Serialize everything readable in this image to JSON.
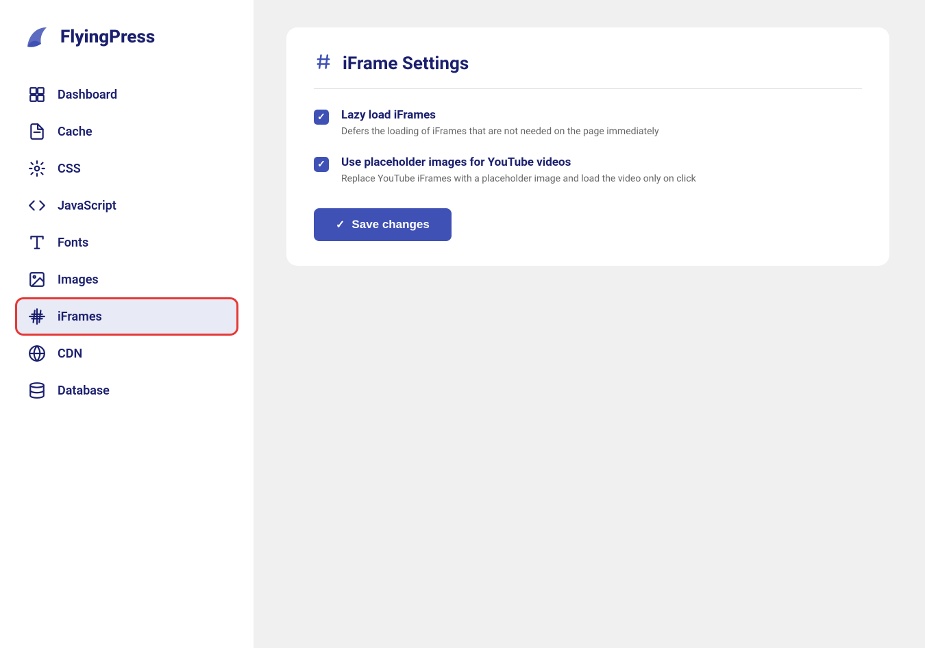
{
  "app": {
    "name": "FlyingPress"
  },
  "sidebar": {
    "items": [
      {
        "id": "dashboard",
        "label": "Dashboard",
        "icon": "dashboard-icon"
      },
      {
        "id": "cache",
        "label": "Cache",
        "icon": "cache-icon"
      },
      {
        "id": "css",
        "label": "CSS",
        "icon": "css-icon"
      },
      {
        "id": "javascript",
        "label": "JavaScript",
        "icon": "javascript-icon"
      },
      {
        "id": "fonts",
        "label": "Fonts",
        "icon": "fonts-icon"
      },
      {
        "id": "images",
        "label": "Images",
        "icon": "images-icon"
      },
      {
        "id": "iframes",
        "label": "iFrames",
        "icon": "iframes-icon",
        "active": true
      },
      {
        "id": "cdn",
        "label": "CDN",
        "icon": "cdn-icon"
      },
      {
        "id": "database",
        "label": "Database",
        "icon": "database-icon"
      }
    ]
  },
  "main": {
    "page_title": "iFrame Settings",
    "settings": [
      {
        "id": "lazy-load",
        "label": "Lazy load iFrames",
        "description": "Defers the loading of iFrames that are not needed on the page immediately",
        "checked": true
      },
      {
        "id": "placeholder-images",
        "label": "Use placeholder images for YouTube videos",
        "description": "Replace YouTube iFrames with a placeholder image and load the video only on click",
        "checked": true
      }
    ],
    "save_button_label": "Save changes"
  },
  "colors": {
    "brand": "#1a1f6e",
    "accent": "#3f51b5",
    "active_bg": "#e8eaf6",
    "active_border": "#e53935"
  }
}
